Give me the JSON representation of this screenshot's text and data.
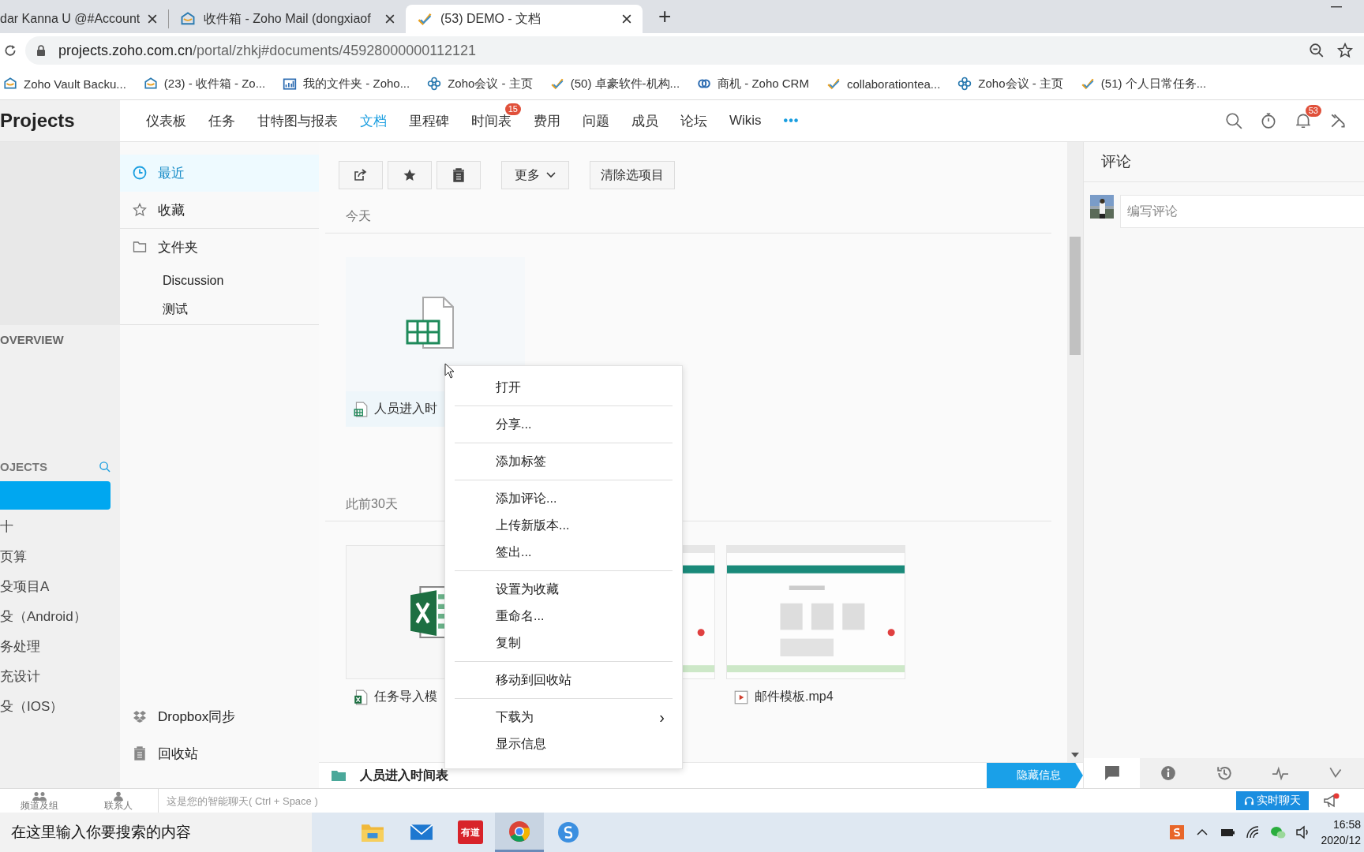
{
  "browser": {
    "tabs": [
      {
        "title": "dar Kanna U @#Account",
        "kind": "plain",
        "selected": false
      },
      {
        "title": "收件箱 - Zoho Mail (dongxiaof",
        "kind": "mail",
        "selected": false
      },
      {
        "title": "(53) DEMO - 文档",
        "kind": "task",
        "selected": true
      }
    ],
    "new_tab": "+",
    "url_host": "projects.zoho.com.cn",
    "url_path": "/portal/zhkj#documents/45928000000112121",
    "bookmarks": [
      {
        "label": "Zoho Vault Backu...",
        "kind": "mail"
      },
      {
        "label": "(23) - 收件箱 - Zo...",
        "kind": "mail"
      },
      {
        "label": "我的文件夹 - Zoho...",
        "kind": "chart"
      },
      {
        "label": "Zoho会议 - 主页",
        "kind": "meeting"
      },
      {
        "label": "(50) 卓豪软件-机构...",
        "kind": "task"
      },
      {
        "label": "商机 - Zoho CRM",
        "kind": "crm"
      },
      {
        "label": "collaborationtea...",
        "kind": "task"
      },
      {
        "label": "Zoho会议 - 主页",
        "kind": "meeting"
      },
      {
        "label": "(51) 个人日常任务...",
        "kind": "task"
      }
    ]
  },
  "app": {
    "brand": "Projects",
    "nav": [
      {
        "label": "仪表板",
        "selected": false
      },
      {
        "label": "任务",
        "selected": false
      },
      {
        "label": "甘特图与报表",
        "selected": false
      },
      {
        "label": "文档",
        "selected": true
      },
      {
        "label": "里程碑",
        "selected": false
      },
      {
        "label": "时间表",
        "selected": false,
        "badge": "15"
      },
      {
        "label": "费用",
        "selected": false
      },
      {
        "label": "问题",
        "selected": false
      },
      {
        "label": "成员",
        "selected": false
      },
      {
        "label": "论坛",
        "selected": false
      },
      {
        "label": "Wikis",
        "selected": false
      }
    ],
    "more": "•••",
    "notifications_badge": "53"
  },
  "sidebar": {
    "overview": "OVERVIEW",
    "projects_heading": "OJECTS",
    "projects": [
      {
        "selected": true
      },
      {
        "label": "十",
        "selected": false
      },
      {
        "label": "页算",
        "selected": false
      },
      {
        "label": "殳项目A",
        "selected": false
      },
      {
        "label": "殳（Android）",
        "selected": false
      },
      {
        "label": "务处理",
        "selected": false
      },
      {
        "label": "充设计",
        "selected": false
      },
      {
        "label": "殳（IOS）",
        "selected": false
      }
    ]
  },
  "docs_nav": {
    "items": [
      {
        "label": "最近",
        "kind": "recent",
        "selected": true
      },
      {
        "label": "收藏",
        "kind": "favorites",
        "selected": false
      },
      {
        "label": "文件夹",
        "kind": "folders",
        "selected": false,
        "children": [
          {
            "label": "Discussion"
          },
          {
            "label": "测试"
          }
        ]
      }
    ],
    "bottom": [
      {
        "label": "Dropbox同步",
        "kind": "dropbox"
      },
      {
        "label": "回收站",
        "kind": "trash"
      }
    ]
  },
  "toolbar": {
    "more": "更多",
    "clear": "清除选项目"
  },
  "sections": [
    {
      "title": "今天",
      "files": [
        {
          "name": "人员进入时",
          "kind": "sheet",
          "selected": true
        }
      ]
    },
    {
      "title": "此前30天",
      "files": [
        {
          "name": "任务导入模",
          "kind": "excel",
          "selected": false
        },
        {
          "kind": "picture",
          "selected": false
        },
        {
          "name": "邮件模板.mp4",
          "kind": "video",
          "selected": false
        }
      ]
    }
  ],
  "context_menu": {
    "groups": [
      [
        {
          "label": "打开",
          "kind": "item"
        }
      ],
      [
        {
          "label": "分享...",
          "kind": "item"
        }
      ],
      [
        {
          "label": "添加标签",
          "kind": "item"
        }
      ],
      [
        {
          "label": "添加评论...",
          "kind": "item"
        },
        {
          "label": "上传新版本...",
          "kind": "item"
        },
        {
          "label": "签出...",
          "kind": "item"
        }
      ],
      [
        {
          "label": "设置为收藏",
          "kind": "item"
        },
        {
          "label": "重命名...",
          "kind": "item"
        },
        {
          "label": "复制",
          "kind": "item"
        }
      ],
      [
        {
          "label": "移动到回收站",
          "kind": "item"
        }
      ],
      [
        {
          "label": "下载为",
          "kind": "submenu",
          "arrow": "›"
        },
        {
          "label": "显示信息",
          "kind": "item"
        }
      ]
    ]
  },
  "comments": {
    "title": "评论",
    "placeholder": "编写评论",
    "tabs": [
      {
        "kind": "comments",
        "selected": true
      },
      {
        "kind": "info",
        "selected": false
      },
      {
        "kind": "history",
        "selected": false
      },
      {
        "kind": "activity",
        "selected": false
      },
      {
        "kind": "links",
        "selected": false
      }
    ]
  },
  "breadcrumb": {
    "path": "人员进入时间表",
    "hide_button": "隐藏信息"
  },
  "chat": {
    "channels": "频道及组",
    "contacts": "联系人",
    "placeholder": "这是您的智能聊天( Ctrl + Space )",
    "live_button": "实时聊天"
  },
  "taskbar": {
    "search": "在这里输入你要搜索的内容",
    "apps": [
      {
        "kind": "explorer",
        "selected": false
      },
      {
        "kind": "mail",
        "selected": false
      },
      {
        "kind": "dictionary",
        "label": "有道",
        "selected": false
      },
      {
        "kind": "browser",
        "selected": true
      },
      {
        "kind": "ime",
        "selected": false
      }
    ],
    "time": "16:58",
    "date": "2020/12"
  }
}
